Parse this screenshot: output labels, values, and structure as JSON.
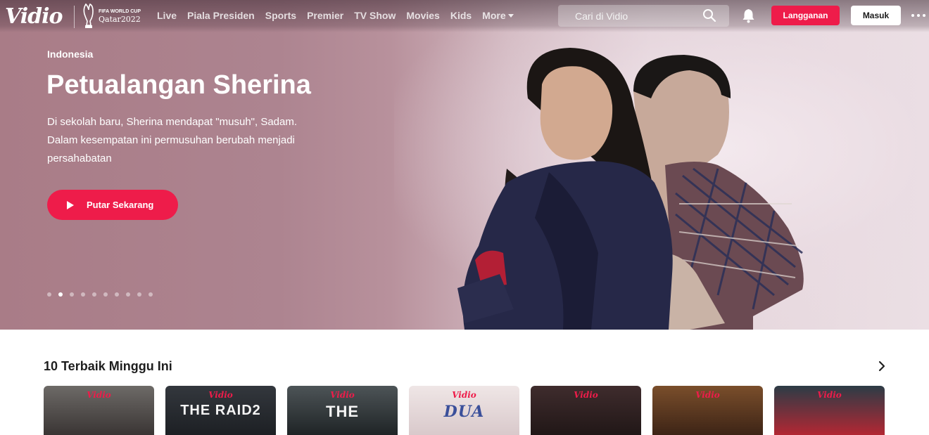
{
  "brand": {
    "name": "Vidio",
    "partner_line1": "FIFA WORLD CUP",
    "partner_line2": "Qatar2022"
  },
  "nav": {
    "links": [
      "Live",
      "Piala Presiden",
      "Sports",
      "Premier",
      "TV Show",
      "Movies",
      "Kids"
    ],
    "more_label": "More"
  },
  "search": {
    "placeholder": "Cari di Vidio"
  },
  "header_buttons": {
    "subscribe": "Langganan",
    "login": "Masuk"
  },
  "hero": {
    "country": "Indonesia",
    "title": "Petualangan Sherina",
    "description": "Di sekolah baru, Sherina mendapat \"musuh\", Sadam. Dalam kesempatan ini permusuhan berubah menjadi persahabatan",
    "play_label": "Putar Sekarang",
    "slides_total": 10,
    "active_slide": 1
  },
  "section": {
    "title": "10 Terbaik Minggu Ini",
    "cards": [
      {
        "logo": "Vidio",
        "title": "",
        "colors": [
          "#6d6a67",
          "#3a3534"
        ]
      },
      {
        "logo": "Vidio",
        "title": "THE RAID2",
        "colors": [
          "#33373d",
          "#1d2024"
        ]
      },
      {
        "logo": "Vidio",
        "title": "THE",
        "colors": [
          "#4d5457",
          "#1f2426"
        ]
      },
      {
        "logo": "Vidio",
        "title": "DUA",
        "colors": [
          "#efe6e6",
          "#d9c9cb"
        ]
      },
      {
        "logo": "Vidio",
        "title": "",
        "colors": [
          "#3f2c2d",
          "#211717"
        ]
      },
      {
        "logo": "Vidio",
        "title": "",
        "colors": [
          "#7a4e2b",
          "#3d2416"
        ]
      },
      {
        "logo": "Vidio",
        "title": "",
        "colors": [
          "#2c3c46",
          "#b32733"
        ]
      }
    ]
  },
  "colors": {
    "accent": "#ee1c4a",
    "hero_bg": "#ad8490"
  }
}
